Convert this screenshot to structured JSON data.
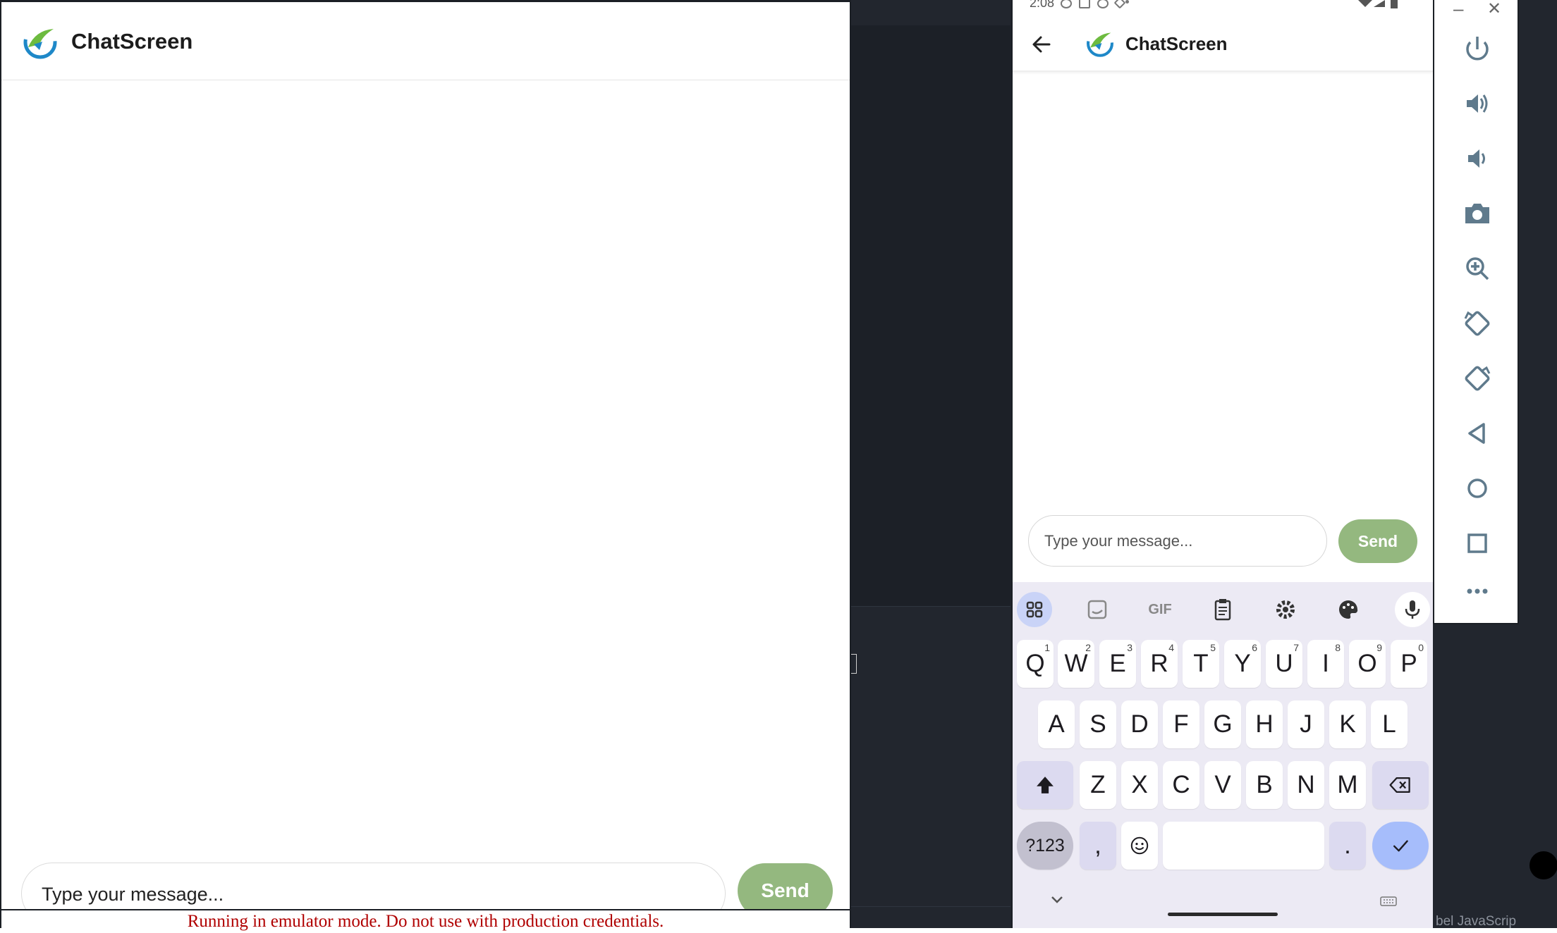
{
  "web_app": {
    "title": "ChatScreen",
    "input_placeholder": "Type your message...",
    "send_label": "Send",
    "banner": "Running in emulator mode. Do not use with production credentials."
  },
  "ide": {
    "status_text": "bel JavaScrip"
  },
  "phone": {
    "status_time": "2:08",
    "title": "ChatScreen",
    "input_placeholder": "Type your message...",
    "send_label": "Send",
    "keyboard": {
      "toolbar": [
        "apps-grid-icon",
        "sticker-icon",
        "GIF",
        "clipboard-icon",
        "settings-icon",
        "palette-icon",
        "mic-icon"
      ],
      "row1": [
        "Q",
        "W",
        "E",
        "R",
        "T",
        "Y",
        "U",
        "I",
        "O",
        "P"
      ],
      "row1_hints": [
        "1",
        "2",
        "3",
        "4",
        "5",
        "6",
        "7",
        "8",
        "9",
        "0"
      ],
      "row2": [
        "A",
        "S",
        "D",
        "F",
        "G",
        "H",
        "J",
        "K",
        "L"
      ],
      "row3": [
        "Z",
        "X",
        "C",
        "V",
        "B",
        "N",
        "M"
      ],
      "symbols_label": "?123",
      "comma": ",",
      "period": "."
    }
  },
  "emulator_toolbar": {
    "minimize": "–",
    "close": "✕",
    "buttons": [
      "power-icon",
      "volume-up-icon",
      "volume-down-icon",
      "camera-icon",
      "zoom-icon",
      "rotate-left-icon",
      "rotate-right-icon",
      "back-icon",
      "home-icon",
      "overview-icon",
      "more-icon"
    ]
  },
  "colors": {
    "send_bg": "#94b87f",
    "banner_text": "#b00000",
    "ide_bg": "#22262e",
    "keyboard_bg": "#eceaf4",
    "key_accent": "#a6bdfb"
  }
}
